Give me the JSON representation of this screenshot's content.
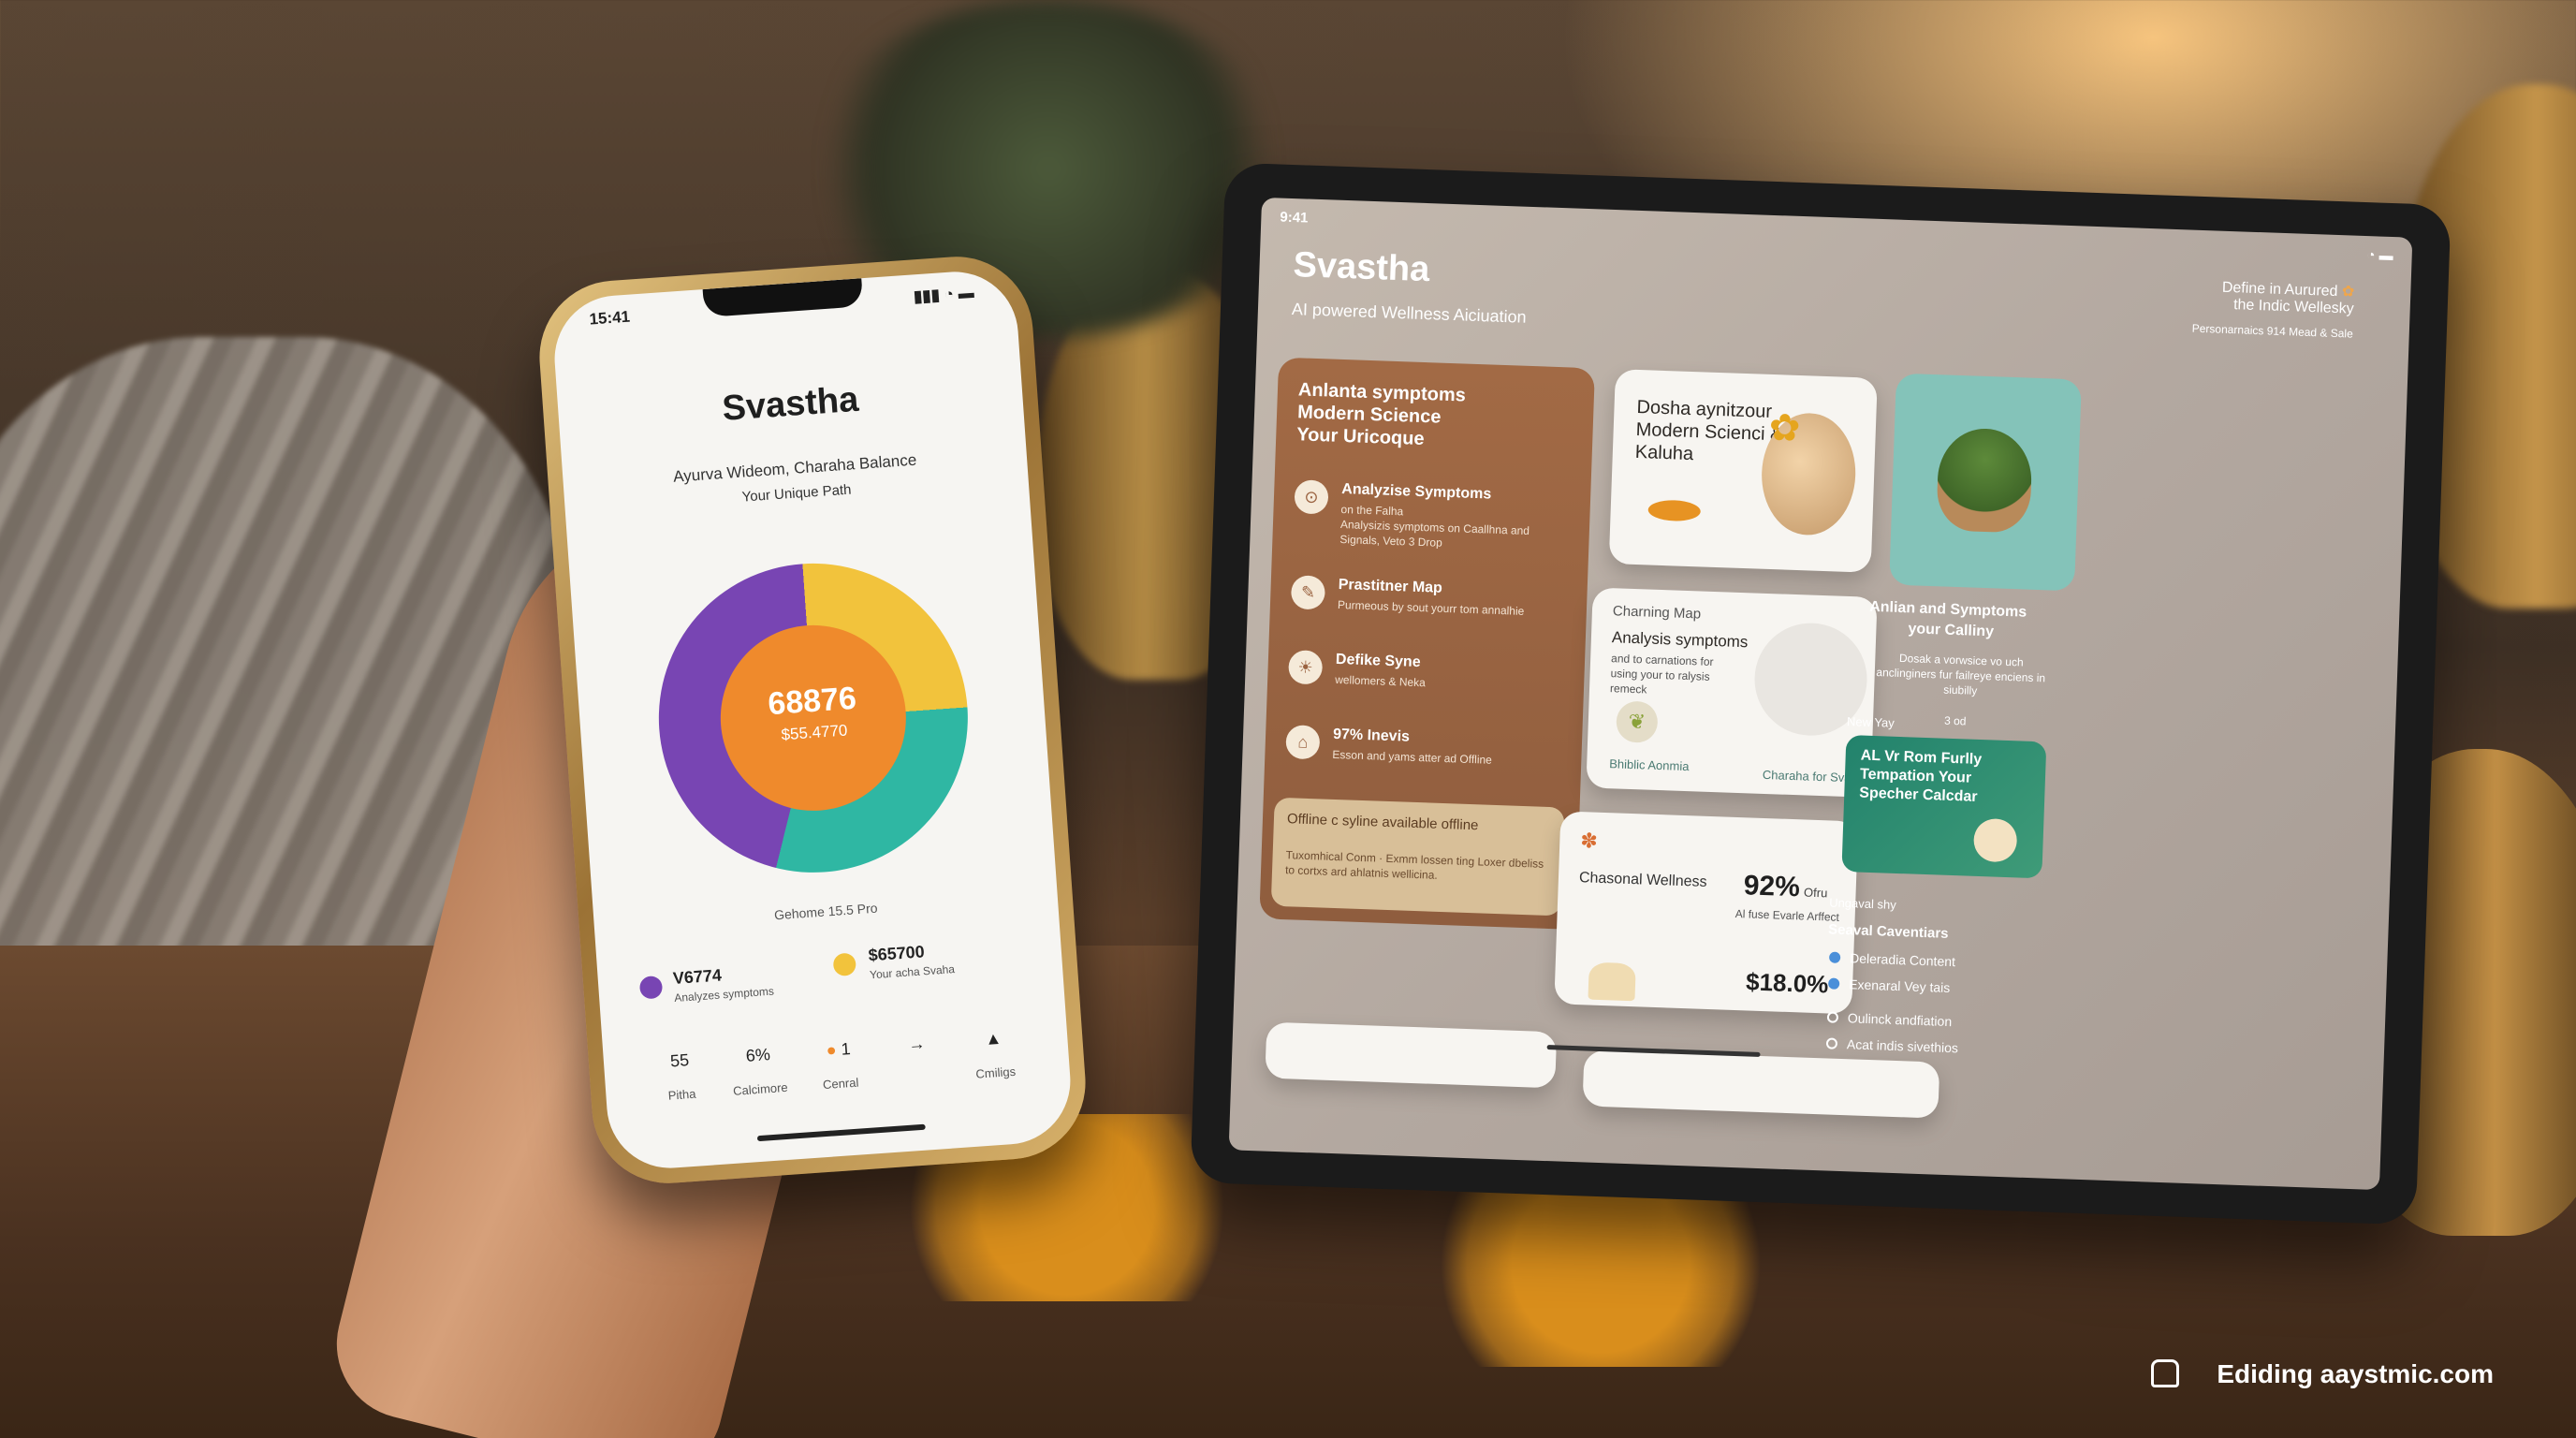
{
  "phone": {
    "status_time": "15:41",
    "title": "Svastha",
    "subtitle_1": "Ayurva Wideom, Charaha Balance",
    "subtitle_2": "Your Unique Path",
    "donut": {
      "big": "68876",
      "small": "$55.4770",
      "colors": [
        "#f2c33c",
        "#2fb7a3",
        "#7845b3",
        "#ef8a2c"
      ]
    },
    "footer_label": "Gehome 15.5 Pro",
    "legend": [
      {
        "value": "V6774",
        "label": "Analyzes symptoms",
        "color": "#7845b3"
      },
      {
        "value": "$65700",
        "label": "Your acha Svaha",
        "color": "#f2c33c"
      }
    ],
    "nav": [
      {
        "value": "55",
        "label": "Pitha"
      },
      {
        "value": "6%",
        "label": "Calcimore"
      },
      {
        "value": "1",
        "label": "Cenral"
      },
      {
        "value": "→",
        "label": ""
      },
      {
        "value": "",
        "label": "Cmiligs"
      }
    ]
  },
  "tablet": {
    "status_left": "9:41",
    "title": "Svastha",
    "subtitle": "AI powered Wellness Aiciuation",
    "right_header_1": "Define in Aurured",
    "right_header_2": "the Indic Wellesky",
    "right_header_3": "Personarnaics 914 Mead & Sale",
    "left_panel": {
      "heading_1": "Anlanta symptoms",
      "heading_2": "Modern Science",
      "heading_3": "Your Uricoque",
      "items": [
        {
          "title": "Analyzise Symptoms",
          "desc_1": "on the Falha",
          "desc_2": "Analysizis symptoms on Caallhna and Signals, Veto 3 Drop"
        },
        {
          "title": "Prastitner Map",
          "desc_1": "Purmeous by sout yourr tom annalhie",
          "desc_2": ""
        },
        {
          "title": "Defike Syne",
          "desc_1": "wellomers & Neka",
          "desc_2": ""
        },
        {
          "title": "97% Inevis",
          "desc_1": "Esson and yams atter ad Offline",
          "desc_2": ""
        }
      ],
      "offline_title": "Offline c syline available offline",
      "offline_desc": "Tuxomhical Conm · Exmm lossen ting Loxer dbeliss to cortxs ard ahlatnis wellicina."
    },
    "card1": {
      "line_1": "Dosha aynitzour",
      "line_2": "Modern Scienci &",
      "line_3": "Kaluha"
    },
    "card2": {
      "title": "Charning Map",
      "heading": "Analysis symptoms",
      "desc": "and to carnations for using your to ralysis remeck",
      "tag_1": "Bhiblic Aonmia",
      "tag_2": "Charaha for Svasha"
    },
    "card3": {
      "title": "Chasonal Wellness",
      "percent_1": "92%",
      "percent_1_unit": "Ofru",
      "percent_1_desc": "Al fuse Evarle Arffect",
      "percent_2": "$18.0%"
    },
    "right": {
      "plant_caption_1": "Anlian and Symptoms",
      "plant_caption_2": "your Calliny",
      "plant_desc": "Dosak a vorwsice vo uch anclinginers fur failreye enciens in siubilly",
      "plant_note": "3 od",
      "new_label": "New Yay",
      "green_card": "AL Vr Rom Furlly Tempation Your Specher Calcdar",
      "ungaval": "Ungaval shy",
      "list_title": "Seaval Caventiars",
      "list": [
        "Deleradia Content",
        "Exenaral Vey tais",
        "Oulinck andfiation",
        "Acat indis sivethios"
      ]
    }
  },
  "watermark": "Ediding aaystmic.com"
}
